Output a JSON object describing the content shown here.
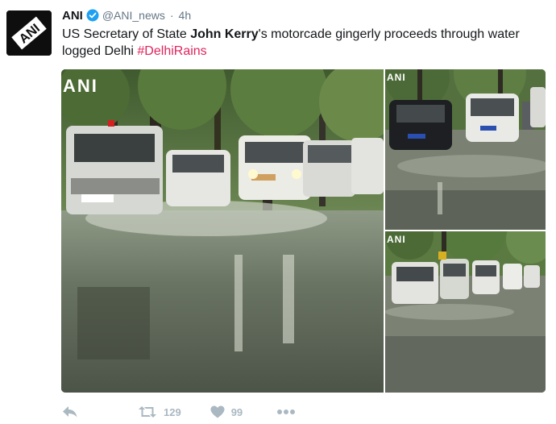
{
  "tweet": {
    "name": "ANI",
    "handle": "@ANI_news",
    "separator": "·",
    "time": "4h",
    "text_prefix": "US Secretary of State ",
    "text_bold": "John Kerry",
    "text_suffix": "'s motorcade gingerly proceeds through water logged Delhi ",
    "hashtag": "#DelhiRains",
    "avatar_logo": "ANI",
    "watermark": "ANI"
  },
  "actions": {
    "retweet_count": "129",
    "like_count": "99"
  },
  "icons": {
    "verified": "verified-badge-icon",
    "reply": "reply-icon",
    "retweet": "retweet-icon",
    "like": "heart-icon",
    "more": "more-dots-icon"
  },
  "colors": {
    "hashtag": "#e0245e",
    "verified": "#1da1f2",
    "secondary": "#657786",
    "action": "#aab8c2"
  }
}
